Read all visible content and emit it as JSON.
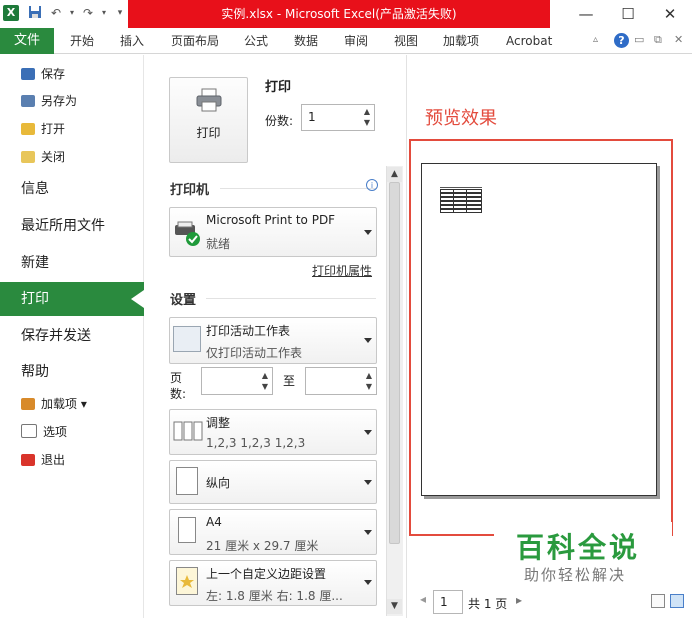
{
  "window": {
    "title": "实例.xlsx - Microsoft Excel(产品激活失败)",
    "controls": [
      "—",
      "☐",
      "✕"
    ]
  },
  "quick_access": {
    "icons": [
      "save-icon",
      "undo-icon",
      "redo-icon",
      "customize-icon"
    ]
  },
  "ribbon": {
    "tabs": [
      "文件",
      "开始",
      "插入",
      "页面布局",
      "公式",
      "数据",
      "审阅",
      "视图",
      "加载项",
      "Acrobat"
    ]
  },
  "backstage_nav": {
    "small_items_top": [
      "保存",
      "另存为",
      "打开",
      "关闭"
    ],
    "big_items": [
      "信息",
      "最近所用文件",
      "新建",
      "打印",
      "保存并发送",
      "帮助"
    ],
    "small_items_bottom": [
      "加载项 ▾",
      "选项",
      "退出"
    ],
    "selected": "打印"
  },
  "print": {
    "button_label": "打印",
    "heading": "打印",
    "copies_label": "份数:",
    "copies_value": "1"
  },
  "printer": {
    "section_title": "打印机",
    "name": "Microsoft Print to PDF",
    "status": "就绪",
    "properties_link": "打印机属性"
  },
  "settings": {
    "section_title": "设置",
    "sheets": {
      "title": "打印活动工作表",
      "subtitle": "仅打印活动工作表"
    },
    "pages_label": "页数:",
    "pages_to": "至",
    "collate": {
      "title": "调整",
      "subtitle": "1,2,3    1,2,3    1,2,3"
    },
    "orientation": {
      "title": "纵向"
    },
    "paper": {
      "title": "A4",
      "subtitle": "21 厘米 x 29.7 厘米"
    },
    "margins": {
      "title": "上一个自定义边距设置",
      "subtitle": "左: 1.8 厘米    右: 1.8 厘..."
    }
  },
  "preview": {
    "annotation": "预览效果",
    "page_current": "1",
    "page_total": "共 1 页"
  },
  "watermark": {
    "main": "百科全说",
    "sub": "助你轻松解决"
  }
}
